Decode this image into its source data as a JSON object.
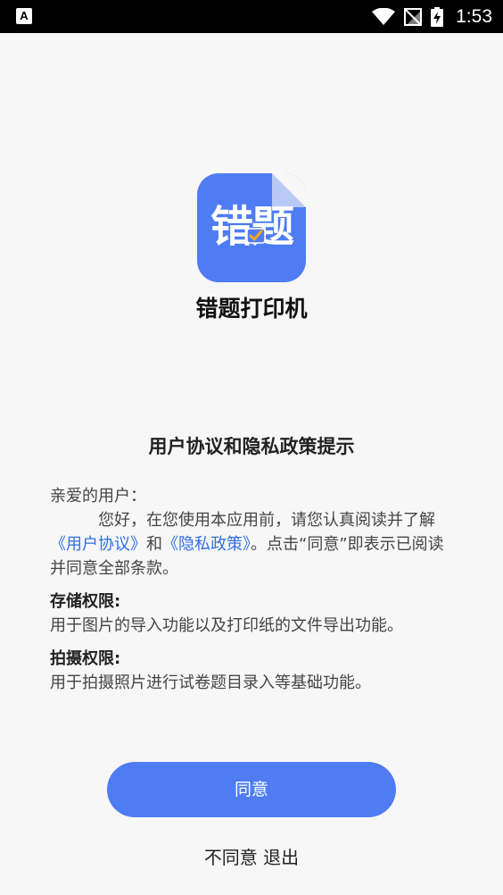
{
  "statusbar": {
    "notification_icon_label": "A",
    "time": "1:53"
  },
  "app": {
    "icon_text": "错题",
    "name": "错题打印机"
  },
  "policy": {
    "title": "用户协议和隐私政策提示",
    "greeting": "亲爱的用户：",
    "intro_part1": "您好，在您使用本应用前，请您认真阅读并了解",
    "user_agreement_link": "《用户协议》",
    "and_text": "和",
    "privacy_policy_link": "《隐私政策》",
    "intro_part2": "。点击“同意”即表示已阅读并同意全部条款。",
    "storage_title": "存储权限:",
    "storage_desc": "用于图片的导入功能以及打印纸的文件导出功能。",
    "camera_title": "拍摄权限:",
    "camera_desc": "用于拍摄照片进行试卷题目录入等基础功能。"
  },
  "buttons": {
    "agree": "同意",
    "disagree": "不同意 退出"
  },
  "colors": {
    "accent": "#4f7cf3",
    "link": "#2f6fe4",
    "background": "#f7f7f7"
  }
}
